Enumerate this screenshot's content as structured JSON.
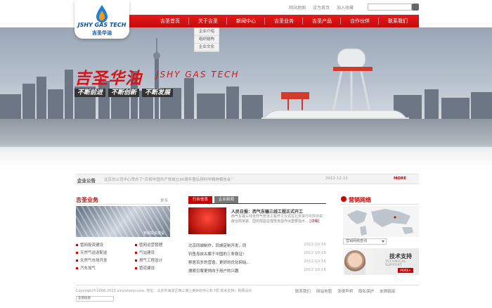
{
  "logo": {
    "en": "JSHY GAS TECH",
    "cn": "吉圣华油"
  },
  "toplinks": [
    "网站地图",
    "设为首页",
    "加入收藏"
  ],
  "nav": [
    "吉圣首页",
    "关于吉圣",
    "新闻中心",
    "吉圣业务",
    "吉圣产品",
    "合作伙伴",
    "联系我们"
  ],
  "submenu": [
    "企业介绍",
    "组织结构",
    "企业文化"
  ],
  "banner": {
    "brand_cn": "吉圣华油",
    "brand_en": "JSHY GAS TECH",
    "mottos": [
      "不断前进",
      "不断创新",
      "不断发展"
    ]
  },
  "notice": {
    "label": "企业公告",
    "text": "北京总公司中心举办了“庆祝中国共产党成立90周年暨弘扬科学精神报告会”",
    "date": "2012-12-11",
    "more": "MORE"
  },
  "business": {
    "title": "吉圣业务",
    "more": "更多",
    "caption": "管网投资建设",
    "items": [
      "管网投资建设",
      "管网运营管理",
      "天然气运送配送",
      "气站建设",
      "天然气市场开发",
      "燃气工程设计",
      "汽车加气",
      "管道建设"
    ]
  },
  "news": {
    "tabs": [
      "行业信息",
      "企业新闻"
    ],
    "headline": "人民日报：西气东输三线工程正式开工",
    "summary": "西气东输三线天然气管道工程开工仪式在北京举行中共中央政治局常委、国务院副总理李克强作出重要指示...",
    "detail": "[详细]",
    "list": [
      {
        "title": "北京同城制作，同城定制开发，同",
        "date": "2012-10-16"
      },
      {
        "title": "钓鱼岛自古属于中国的三条铁证!",
        "date": "2012-10-16"
      },
      {
        "title": "移居百岁的营造，更好的优化网站...",
        "date": "2012-10-16"
      },
      {
        "title": "搜索引擎更倾向于用户的兴趣",
        "date": "2012-10-16"
      }
    ]
  },
  "network": {
    "title": "营销网络",
    "select": "营销网络查询",
    "support_title": "技术支持",
    "support_sub": "TECHNICAL SUPPORT",
    "support_more": "MORE+"
  },
  "footer": {
    "copy": "Copyright©2006-2010 xinyishenji.com.  地址：北京市海淀区西三旗上奥世纪中心B-7层  技术支持：新颖设计",
    "links": [
      "联系我们",
      "网站地图",
      "法律声明",
      "隐私保护",
      "友情链接"
    ],
    "flink": "友情链接"
  }
}
